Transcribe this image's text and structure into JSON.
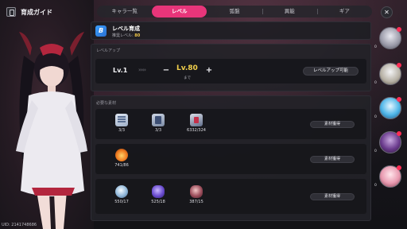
{
  "sidebar": {
    "guide_label": "育成ガイド",
    "uid": "UID: 2141748686"
  },
  "tabs": [
    {
      "label": "キャラ一覧",
      "active": false
    },
    {
      "label": "レベル",
      "active": true
    },
    {
      "label": "弧盤",
      "active": false
    },
    {
      "label": "異能",
      "active": false
    },
    {
      "label": "ギア",
      "active": false
    }
  ],
  "close_label": "✕",
  "header": {
    "badge": "B",
    "title": "レベル育成",
    "sub_prefix": "推奨レベル: ",
    "sub_value": "80"
  },
  "level_up": {
    "section_label": "レベルアップ",
    "current": "Lv.1",
    "arrows": "›››››",
    "minus": "−",
    "target": "Lv.80",
    "target_suffix": "まで",
    "plus": "+",
    "possible_label": "レベルアップ可能"
  },
  "materials": {
    "section_label": "必要な素材",
    "acquire_label": "素材獲得",
    "rows": [
      {
        "items": [
          {
            "icon": "document-icon",
            "count": "3/3"
          },
          {
            "icon": "book-icon",
            "count": "3/3"
          },
          {
            "icon": "card-icon",
            "count": "6332/324"
          }
        ]
      },
      {
        "items": [
          {
            "icon": "fire-crystal-icon",
            "count": "741/86"
          }
        ]
      },
      {
        "items": [
          {
            "icon": "silver-crystal-icon",
            "count": "550/17"
          },
          {
            "icon": "violet-crystal-icon",
            "count": "525/18"
          },
          {
            "icon": "rose-crystal-icon",
            "count": "387/15"
          }
        ]
      }
    ]
  },
  "avatars": [
    {
      "name": "character-avatar-1",
      "count": "0"
    },
    {
      "name": "character-avatar-2",
      "count": "0"
    },
    {
      "name": "character-avatar-3",
      "count": "0"
    },
    {
      "name": "character-avatar-4",
      "count": "0"
    },
    {
      "name": "character-avatar-5",
      "count": "0"
    }
  ],
  "colors": {
    "accent": "#e8357a",
    "target_level": "#f2d04b",
    "badge_blue": "#3aa0ff"
  }
}
